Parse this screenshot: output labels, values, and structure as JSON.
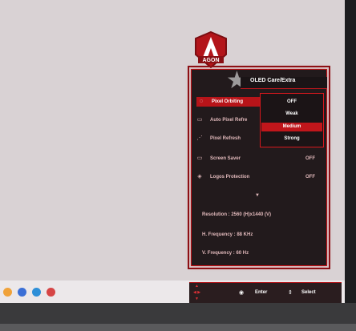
{
  "osd": {
    "title": "OLED Care/Extra",
    "brand": "AGON",
    "menu": [
      {
        "label": "Pixel Orbiting",
        "icon": "orbit-icon",
        "glyph": "◌",
        "selected": true
      },
      {
        "label": "Auto Pixel Refre",
        "icon": "refresh-icon",
        "glyph": "▭",
        "selected": false
      },
      {
        "label": "Pixel Refresh",
        "icon": "pixel-icon",
        "glyph": "⋰",
        "selected": false
      },
      {
        "label": "Screen Saver",
        "icon": "screen-icon",
        "glyph": "▭",
        "selected": false
      },
      {
        "label": "Logos Protection",
        "icon": "logo-icon",
        "glyph": "◈",
        "selected": false
      }
    ],
    "screen_saver_value": "OFF",
    "logos_protection_value": "OFF",
    "pixel_orbiting_options": [
      "OFF",
      "Weak",
      "Medium",
      "Strong"
    ],
    "pixel_orbiting_selected": "Medium",
    "more_indicator": "▼",
    "info": {
      "resolution": "Resolution : 2560 (H)x1440 (V)  ",
      "h_frequency": "H. Frequency :  88 KHz",
      "v_frequency": "V. Frequency :  60 Hz"
    },
    "nav": {
      "enter": "Enter",
      "select": "Select"
    }
  },
  "colors": {
    "accent": "#c0161b",
    "panel": "#221a1c",
    "text_dim": "#e0b8ba"
  }
}
